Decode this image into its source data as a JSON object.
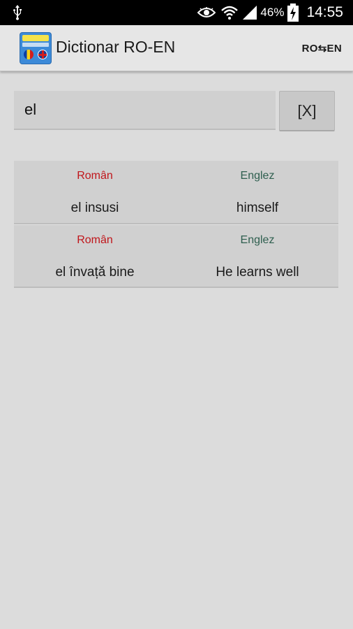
{
  "status_bar": {
    "battery_percent": "46%",
    "time": "14:55",
    "icons": [
      "usb-icon",
      "eye-icon",
      "wifi-icon",
      "signal-icon",
      "battery-charging-icon"
    ]
  },
  "action_bar": {
    "logo_icon": "dictionary-logo-icon",
    "title": "Dictionar RO-EN",
    "lang_toggle": "RO⇆EN"
  },
  "search": {
    "value": "el",
    "clear_label": "[X]"
  },
  "results": [
    {
      "label_ro": "Român",
      "label_en": "Englez",
      "ro": "el insusi",
      "en": "himself"
    },
    {
      "label_ro": "Român",
      "label_en": "Englez",
      "ro": "el învață bine",
      "en": "He learns well"
    }
  ],
  "colors": {
    "label_ro": "#c0161b",
    "label_en": "#2f5f4f",
    "background": "#dcdcdc",
    "item_background": "#d0d0d0"
  }
}
